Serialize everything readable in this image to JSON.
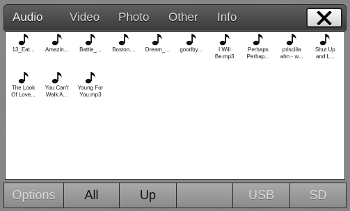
{
  "tabs": [
    {
      "label": "Audio",
      "active": true
    },
    {
      "label": "Video",
      "active": false
    },
    {
      "label": "Photo",
      "active": false
    },
    {
      "label": "Other",
      "active": false
    },
    {
      "label": "Info",
      "active": false
    }
  ],
  "close_icon": "close-icon",
  "files": [
    {
      "icon": "music-note-icon",
      "line1": "13_Eat...",
      "line2": ""
    },
    {
      "icon": "music-note-icon",
      "line1": "Amazin...",
      "line2": ""
    },
    {
      "icon": "music-note-icon",
      "line1": "Battle_...",
      "line2": ""
    },
    {
      "icon": "music-note-icon",
      "line1": "Boston....",
      "line2": ""
    },
    {
      "icon": "music-note-icon",
      "line1": "Dream_...",
      "line2": ""
    },
    {
      "icon": "music-note-icon",
      "line1": "goodby...",
      "line2": ""
    },
    {
      "icon": "music-note-icon",
      "line1": "I Will",
      "line2": "Be.mp3"
    },
    {
      "icon": "music-note-icon",
      "line1": "Perhaps",
      "line2": "Perhap..."
    },
    {
      "icon": "music-note-icon",
      "line1": "priscilla",
      "line2": "ahn - w..."
    },
    {
      "icon": "music-note-icon",
      "line1": "Shut Up",
      "line2": "and L..."
    },
    {
      "icon": "music-note-icon",
      "line1": "The Look",
      "line2": "Of Love..."
    },
    {
      "icon": "music-note-icon",
      "line1": "You Can't",
      "line2": "Walk A..."
    },
    {
      "icon": "music-note-icon",
      "line1": "Young For",
      "line2": "You.mp3"
    }
  ],
  "bottom_buttons": [
    {
      "label": "Options",
      "enabled": false
    },
    {
      "label": "All",
      "enabled": true
    },
    {
      "label": "Up",
      "enabled": true
    },
    {
      "label": "",
      "enabled": false
    },
    {
      "label": "USB",
      "enabled": false
    },
    {
      "label": "SD",
      "enabled": false
    }
  ],
  "colors": {
    "tab_bar": "#4a4a4a",
    "content_bg": "#ffffff",
    "button_bg": "#9a9a9a",
    "disabled_text": "#d6d6d6"
  }
}
